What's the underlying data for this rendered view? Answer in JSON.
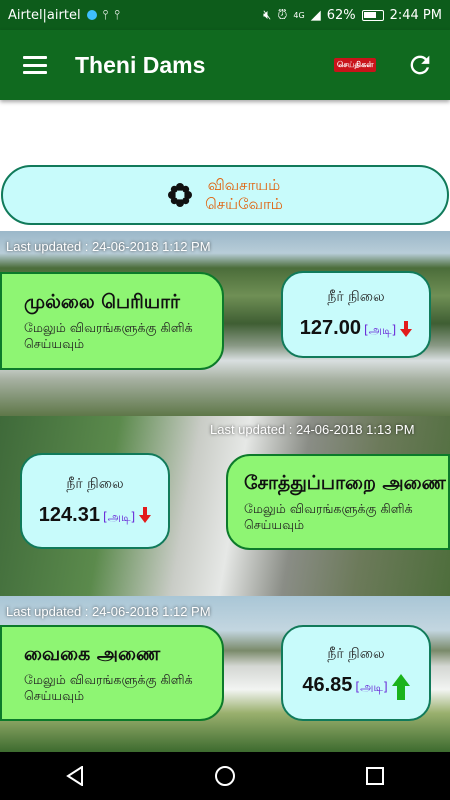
{
  "status_bar": {
    "carrier": "Airtel|airtel",
    "battery": "62%",
    "time": "2:44 PM",
    "network": "4G"
  },
  "app_bar": {
    "title": "Theni Dams",
    "news_badge": "செய்திகள்",
    "menu_icon": "hamburger-menu-icon",
    "refresh_icon": "refresh-icon",
    "color": "#106a1f"
  },
  "farm_button": {
    "label_line1": "விவசாயம்",
    "label_line2": "செய்வோம்",
    "icon": "flower-icon"
  },
  "dams": [
    {
      "updated": "Last updated : 24-06-2018 1:12 PM",
      "name": "முல்லை பெரியார்",
      "more_line1": "மேலும் விவரங்களுக்கு கிளிக்",
      "more_line2": "செய்யவும்",
      "level_label": "நீர் நிலை",
      "level_value": "127.00",
      "unit": "[அடி]",
      "trend": "down"
    },
    {
      "updated": "Last updated : 24-06-2018 1:13 PM",
      "name": "சோத்துப்பாறை அணை",
      "more_line1": "மேலும் விவரங்களுக்கு கிளிக்",
      "more_line2": "செய்யவும்",
      "level_label": "நீர் நிலை",
      "level_value": "124.31",
      "unit": "[அடி]",
      "trend": "down"
    },
    {
      "updated": "Last updated : 24-06-2018 1:12 PM",
      "name": "வைகை அணை",
      "more_line1": "மேலும் விவரங்களுக்கு கிளிக்",
      "more_line2": "செய்யவும்",
      "level_label": "நீர் நிலை",
      "level_value": "46.85",
      "unit": "[அடி]",
      "trend": "up"
    }
  ],
  "nav_bar": {
    "back_icon": "back-triangle-icon",
    "home_icon": "home-circle-icon",
    "recents_icon": "recents-square-icon"
  }
}
